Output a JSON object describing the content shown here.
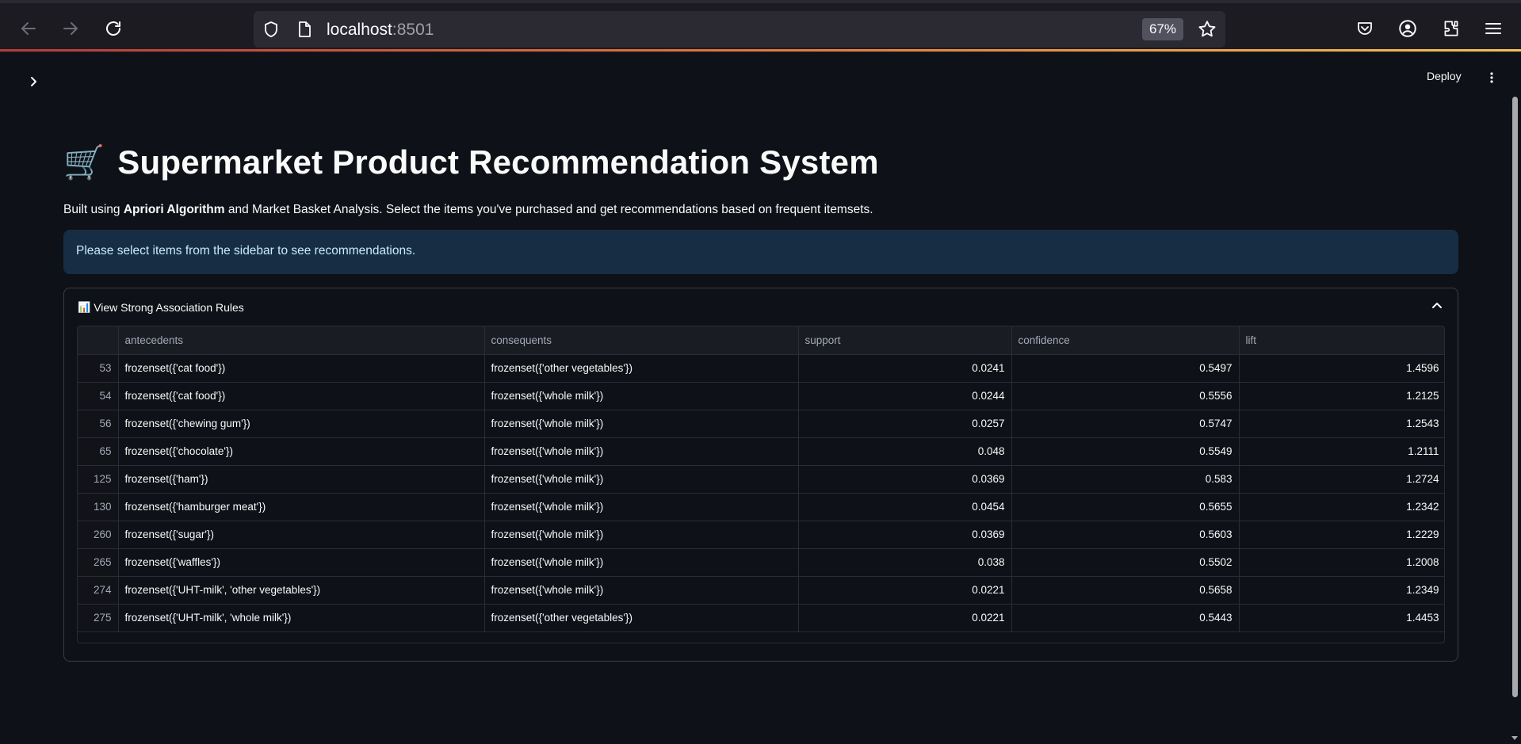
{
  "browser": {
    "url_host": "localhost",
    "url_port": ":8501",
    "zoom": "67%"
  },
  "header": {
    "deploy_label": "Deploy"
  },
  "main": {
    "title_emoji": "🛒",
    "title": "Supermarket Product Recommendation System",
    "subtitle_prefix": "Built using ",
    "subtitle_bold": "Apriori Algorithm",
    "subtitle_suffix": " and Market Basket Analysis. Select the items you've purchased and get recommendations based on frequent itemsets.",
    "info_message": "Please select items from the sidebar to see recommendations."
  },
  "expander": {
    "icon": "📊",
    "label": "View Strong Association Rules"
  },
  "table": {
    "columns": [
      "antecedents",
      "consequents",
      "support",
      "confidence",
      "lift"
    ],
    "rows": [
      {
        "index": "53",
        "antecedents": "frozenset({'cat food'})",
        "consequents": "frozenset({'other vegetables'})",
        "support": "0.0241",
        "confidence": "0.5497",
        "lift": "1.4596"
      },
      {
        "index": "54",
        "antecedents": "frozenset({'cat food'})",
        "consequents": "frozenset({'whole milk'})",
        "support": "0.0244",
        "confidence": "0.5556",
        "lift": "1.2125"
      },
      {
        "index": "56",
        "antecedents": "frozenset({'chewing gum'})",
        "consequents": "frozenset({'whole milk'})",
        "support": "0.0257",
        "confidence": "0.5747",
        "lift": "1.2543"
      },
      {
        "index": "65",
        "antecedents": "frozenset({'chocolate'})",
        "consequents": "frozenset({'whole milk'})",
        "support": "0.048",
        "confidence": "0.5549",
        "lift": "1.2111"
      },
      {
        "index": "125",
        "antecedents": "frozenset({'ham'})",
        "consequents": "frozenset({'whole milk'})",
        "support": "0.0369",
        "confidence": "0.583",
        "lift": "1.2724"
      },
      {
        "index": "130",
        "antecedents": "frozenset({'hamburger meat'})",
        "consequents": "frozenset({'whole milk'})",
        "support": "0.0454",
        "confidence": "0.5655",
        "lift": "1.2342"
      },
      {
        "index": "260",
        "antecedents": "frozenset({'sugar'})",
        "consequents": "frozenset({'whole milk'})",
        "support": "0.0369",
        "confidence": "0.5603",
        "lift": "1.2229"
      },
      {
        "index": "265",
        "antecedents": "frozenset({'waffles'})",
        "consequents": "frozenset({'whole milk'})",
        "support": "0.038",
        "confidence": "0.5502",
        "lift": "1.2008"
      },
      {
        "index": "274",
        "antecedents": "frozenset({'UHT-milk', 'other vegetables'})",
        "consequents": "frozenset({'whole milk'})",
        "support": "0.0221",
        "confidence": "0.5658",
        "lift": "1.2349"
      },
      {
        "index": "275",
        "antecedents": "frozenset({'UHT-milk', 'whole milk'})",
        "consequents": "frozenset({'other vegetables'})",
        "support": "0.0221",
        "confidence": "0.5443",
        "lift": "1.4453"
      }
    ]
  },
  "colors": {
    "background": "#0e1117",
    "info_bg": "#172d43",
    "info_text": "#c7ebff",
    "accent_gradient_start": "#b33a3a"
  }
}
